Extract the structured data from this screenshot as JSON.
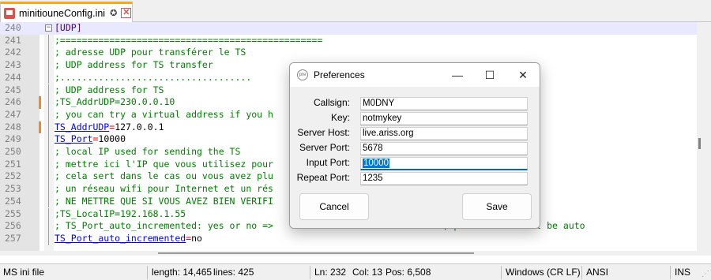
{
  "tab": {
    "title": "minitiouneConfig.ini",
    "pin": "✪",
    "close": "✕"
  },
  "editor": {
    "lines": [
      {
        "num": "240",
        "changed": false,
        "fold": "−",
        "parts": [
          {
            "cls": "c-section",
            "text": "[UDP]"
          }
        ]
      },
      {
        "num": "241",
        "changed": false,
        "fold": "",
        "parts": [
          {
            "cls": "c-comment",
            "text": ";================================================"
          }
        ]
      },
      {
        "num": "242",
        "changed": false,
        "fold": "",
        "parts": [
          {
            "cls": "c-comment",
            "text": "; adresse UDP pour transférer le TS"
          }
        ]
      },
      {
        "num": "243",
        "changed": false,
        "fold": "",
        "parts": [
          {
            "cls": "c-comment",
            "text": "; UDP address for TS transfer"
          }
        ]
      },
      {
        "num": "244",
        "changed": false,
        "fold": "",
        "parts": [
          {
            "cls": "c-comment",
            "text": ";..................................."
          }
        ]
      },
      {
        "num": "245",
        "changed": false,
        "fold": "",
        "parts": [
          {
            "cls": "c-comment",
            "text": "; UDP address for TS"
          }
        ]
      },
      {
        "num": "246",
        "changed": true,
        "fold": "",
        "parts": [
          {
            "cls": "c-comment",
            "text": ";TS_AddrUDP=230.0.0.10"
          }
        ]
      },
      {
        "num": "247",
        "changed": false,
        "fold": "",
        "parts": [
          {
            "cls": "c-comment",
            "text": "; you can try a virtual address if you h"
          }
        ]
      },
      {
        "num": "248",
        "changed": true,
        "fold": "",
        "parts": [
          {
            "cls": "c-key",
            "text": "TS_AddrUDP"
          },
          {
            "cls": "c-op",
            "text": "="
          },
          {
            "cls": "c-val",
            "text": "127.0.0.1"
          }
        ]
      },
      {
        "num": "249",
        "changed": false,
        "fold": "",
        "parts": [
          {
            "cls": "c-key",
            "text": "TS_Port"
          },
          {
            "cls": "c-op",
            "text": "="
          },
          {
            "cls": "c-val",
            "text": "10000"
          }
        ]
      },
      {
        "num": "250",
        "changed": false,
        "fold": "",
        "parts": [
          {
            "cls": "c-comment",
            "text": "; local IP used for sending the TS"
          }
        ]
      },
      {
        "num": "251",
        "changed": false,
        "fold": "",
        "parts": [
          {
            "cls": "c-comment",
            "text": "; mettre ici l'IP que vous utilisez pour"
          }
        ]
      },
      {
        "num": "252",
        "changed": false,
        "fold": "",
        "parts": [
          {
            "cls": "c-comment",
            "text": "; cela sert dans le cas ou vous avez plu"
          }
        ]
      },
      {
        "num": "253",
        "changed": false,
        "fold": "",
        "parts": [
          {
            "cls": "c-comment",
            "text": "; un réseau wifi pour Internet et un rés"
          }
        ]
      },
      {
        "num": "254",
        "changed": false,
        "fold": "",
        "parts": [
          {
            "cls": "c-comment",
            "text": "; NE METTRE QUE SI VOUS AVEZ BIEN VERIFI"
          }
        ]
      },
      {
        "num": "255",
        "changed": false,
        "fold": "",
        "parts": [
          {
            "cls": "c-comment",
            "text": ";TS_LocalIP=192.168.1.55"
          }
        ]
      },
      {
        "num": "256",
        "changed": false,
        "fold": "",
        "parts": [
          {
            "cls": "c-comment",
            "text": "; TS_Port_auto_incremented: yes or no =>                              e, port number will be auto"
          }
        ]
      },
      {
        "num": "257",
        "changed": false,
        "fold": "",
        "parts": [
          {
            "cls": "c-key",
            "text": "TS_Port_auto_incremented"
          },
          {
            "cls": "c-op",
            "text": "="
          },
          {
            "cls": "c-val",
            "text": "no"
          }
        ]
      }
    ]
  },
  "statusbar": {
    "language": "MS ini file",
    "length": "length: 14,465",
    "lines": "lines: 425",
    "ln": "Ln: 232",
    "col": "Col: 13",
    "pos": "Pos: 6,508",
    "eol": "Windows (CR LF)",
    "encoding": "ANSI",
    "mode": "INS"
  },
  "dialog": {
    "title": "Preferences",
    "icon_text": "pre",
    "minimize": "—",
    "maximize": "☐",
    "close": "✕",
    "fields": {
      "callsign": {
        "label": "Callsign:",
        "value": "M0DNY"
      },
      "key": {
        "label": "Key:",
        "value": "notmykey"
      },
      "server_host": {
        "label": "Server Host:",
        "value": "live.ariss.org"
      },
      "server_port": {
        "label": "Server Port:",
        "value": "5678"
      },
      "input_port": {
        "label": "Input Port:",
        "value": "10000"
      },
      "repeat_port": {
        "label": "Repeat Port:",
        "value": "1235"
      }
    },
    "cancel_label": "Cancel",
    "save_label": "Save"
  },
  "colors": {
    "tab_accent": "#f5a623",
    "comment": "#008000",
    "key": "#0000ff",
    "operator": "#ff0000",
    "change_marker": "#f08c28",
    "selection": "#0078d7"
  }
}
